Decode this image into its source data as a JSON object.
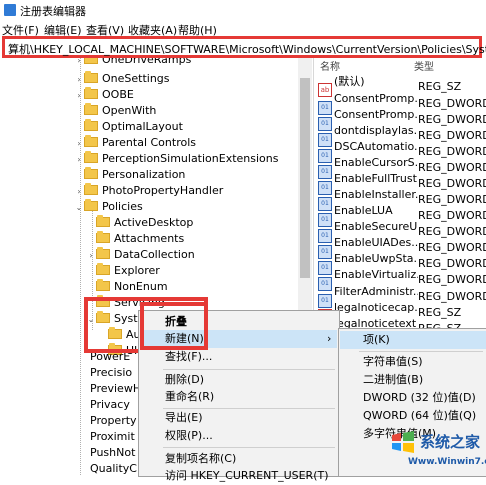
{
  "window": {
    "title": "注册表编辑器"
  },
  "menu": [
    "文件(F)",
    "编辑(E)",
    "查看(V)",
    "收藏夹(A)",
    "帮助(H)"
  ],
  "address": {
    "path": "算机\\HKEY_LOCAL_MACHINE\\SOFTWARE\\Microsoft\\Windows\\CurrentVersion\\Policies\\System"
  },
  "tree": {
    "items": [
      {
        "label": "OneDriveRamps",
        "level": 0
      },
      {
        "label": "OneSettings",
        "level": 0
      },
      {
        "label": "OOBE",
        "level": 0
      },
      {
        "label": "OpenWith",
        "level": 0
      },
      {
        "label": "OptimalLayout",
        "level": 0
      },
      {
        "label": "Parental Controls",
        "level": 0
      },
      {
        "label": "PerceptionSimulationExtensions",
        "level": 0
      },
      {
        "label": "Personalization",
        "level": 0
      },
      {
        "label": "PhotoPropertyHandler",
        "level": 0
      },
      {
        "label": "Policies",
        "level": 0
      },
      {
        "label": "ActiveDesktop",
        "level": 1
      },
      {
        "label": "Attachments",
        "level": 1
      },
      {
        "label": "DataCollection",
        "level": 1
      },
      {
        "label": "Explorer",
        "level": 1
      },
      {
        "label": "NonEnum",
        "level": 1
      },
      {
        "label": "Servicing",
        "level": 1
      },
      {
        "label": "System",
        "level": 1
      },
      {
        "label": "Au",
        "level": 2
      },
      {
        "label": "UI",
        "level": 2
      },
      {
        "label": "PowerE",
        "level": 0
      },
      {
        "label": "Precisio",
        "level": 0
      },
      {
        "label": "PreviewH",
        "level": 0
      },
      {
        "label": "Privacy",
        "level": 0
      },
      {
        "label": "Property",
        "level": 0
      },
      {
        "label": "Proximit",
        "level": 0
      },
      {
        "label": "PushNot",
        "level": 0
      },
      {
        "label": "QualityC",
        "level": 0
      }
    ]
  },
  "values": {
    "header": {
      "name": "名称",
      "type": "类型"
    },
    "rows": [
      {
        "icon": "ab",
        "name": "(默认)",
        "type": "REG_SZ"
      },
      {
        "icon": "dw",
        "name": "ConsentPromp...",
        "type": "REG_DWORD"
      },
      {
        "icon": "dw",
        "name": "ConsentPromp...",
        "type": "REG_DWORD"
      },
      {
        "icon": "dw",
        "name": "dontdisplaylas...",
        "type": "REG_DWORD"
      },
      {
        "icon": "dw",
        "name": "DSCAutomatio...",
        "type": "REG_DWORD"
      },
      {
        "icon": "dw",
        "name": "EnableCursorS...",
        "type": "REG_DWORD"
      },
      {
        "icon": "dw",
        "name": "EnableFullTrust...",
        "type": "REG_DWORD"
      },
      {
        "icon": "dw",
        "name": "EnableInstaller...",
        "type": "REG_DWORD"
      },
      {
        "icon": "dw",
        "name": "EnableLUA",
        "type": "REG_DWORD"
      },
      {
        "icon": "dw",
        "name": "EnableSecureU...",
        "type": "REG_DWORD"
      },
      {
        "icon": "dw",
        "name": "EnableUIADes...",
        "type": "REG_DWORD"
      },
      {
        "icon": "dw",
        "name": "EnableUwpSta...",
        "type": "REG_DWORD"
      },
      {
        "icon": "dw",
        "name": "EnableVirtualiz...",
        "type": "REG_DWORD"
      },
      {
        "icon": "dw",
        "name": "FilterAdministr...",
        "type": "REG_DWORD"
      },
      {
        "icon": "ab",
        "name": "legalnoticecap...",
        "type": "REG_SZ"
      },
      {
        "icon": "ab",
        "name": "legalnoticetext",
        "type": "REG_SZ"
      }
    ]
  },
  "context_menu": {
    "items": [
      "折叠",
      "新建(N)",
      "查找(F)...",
      "删除(D)",
      "重命名(R)",
      "导出(E)",
      "权限(P)...",
      "复制项名称(C)",
      "访问 HKEY_CURRENT_USER(T)"
    ]
  },
  "submenu": {
    "items": [
      "项(K)",
      "字符串值(S)",
      "二进制值(B)",
      "DWORD (32 位)值(D)",
      "QWORD (64 位)值(Q)",
      "多字符串值(M)"
    ]
  },
  "watermark": {
    "brand": "系统之家",
    "url": "Www.Winwin7.com"
  },
  "colors": {
    "highlight": "#cce4f7",
    "annotation": "#e53935",
    "folder": "#f3c64a"
  }
}
